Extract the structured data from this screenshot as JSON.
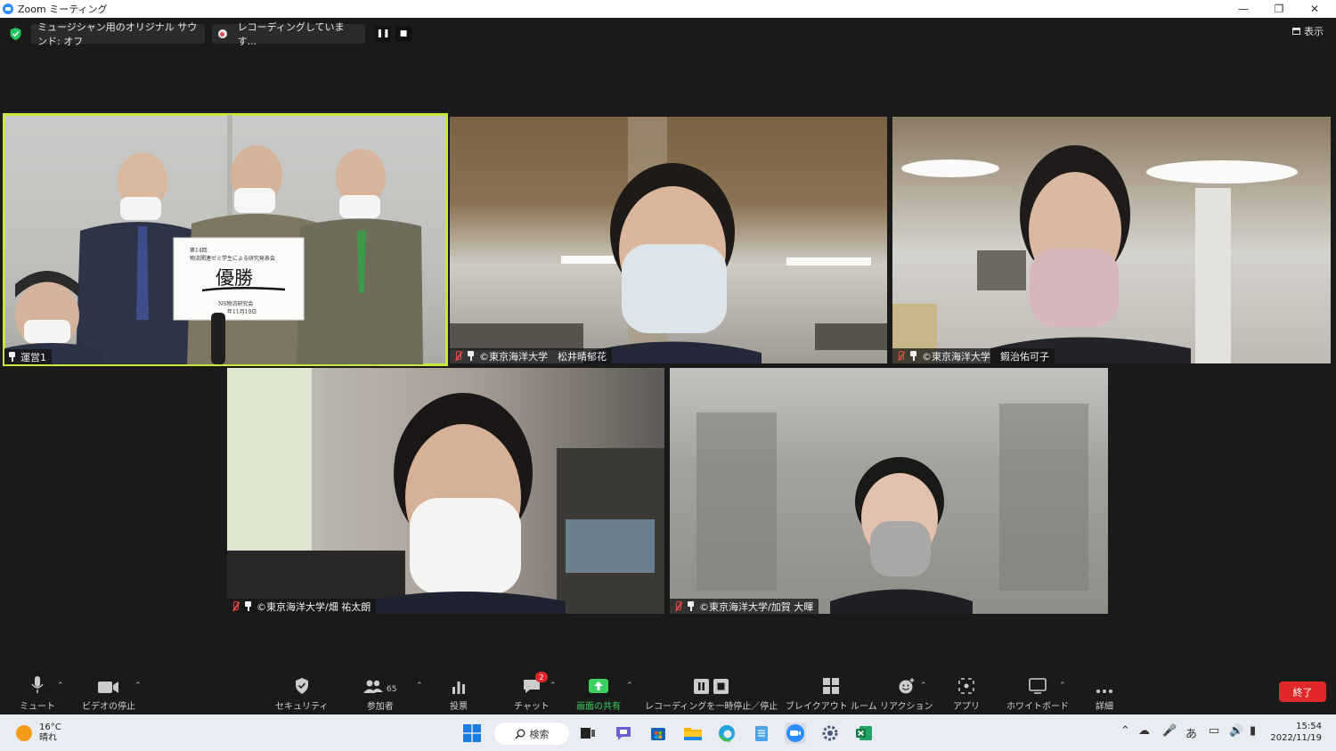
{
  "window": {
    "title": "Zoom ミーティング"
  },
  "topstrip": {
    "original_sound": "ミュージシャン用のオリジナル サウンド: オフ",
    "recording_status": "レコーディングしています...",
    "view_label": "表示"
  },
  "tiles": [
    {
      "name": "運営1",
      "active": true
    },
    {
      "name": "©東京海洋大学　松井晴郁花"
    },
    {
      "name": "©東京海洋大学　鍜治佑可子"
    },
    {
      "name": "©東京海洋大学/畑 祐太朗"
    },
    {
      "name": "©東京海洋大学/加賀 大暉"
    }
  ],
  "sign": {
    "line1": "第14回",
    "line2": "物流関連ゼミ学生による研究発表会",
    "main": "優勝",
    "org": "NS物流研究会",
    "date": "年11月19日"
  },
  "toolbar": {
    "mute": "ミュート",
    "video": "ビデオの停止",
    "security": "セキュリティ",
    "participants": "参加者",
    "participants_count": "65",
    "polls": "投票",
    "chat": "チャット",
    "chat_badge": "2",
    "share": "画面の共有",
    "recording": "レコーディングを一時停止／停止",
    "breakout": "ブレイクアウト ルーム",
    "reactions": "リアクション",
    "apps": "アプリ",
    "whiteboard": "ホワイトボード",
    "more": "詳細",
    "end": "終了"
  },
  "taskbar": {
    "temperature": "16°C",
    "weather": "晴れ",
    "search": "検索",
    "ime": "あ",
    "time": "15:54",
    "date": "2022/11/19"
  },
  "colors": {
    "active_speaker": "#c9e83c",
    "end_button": "#e02828",
    "share_green": "#3bd161"
  }
}
